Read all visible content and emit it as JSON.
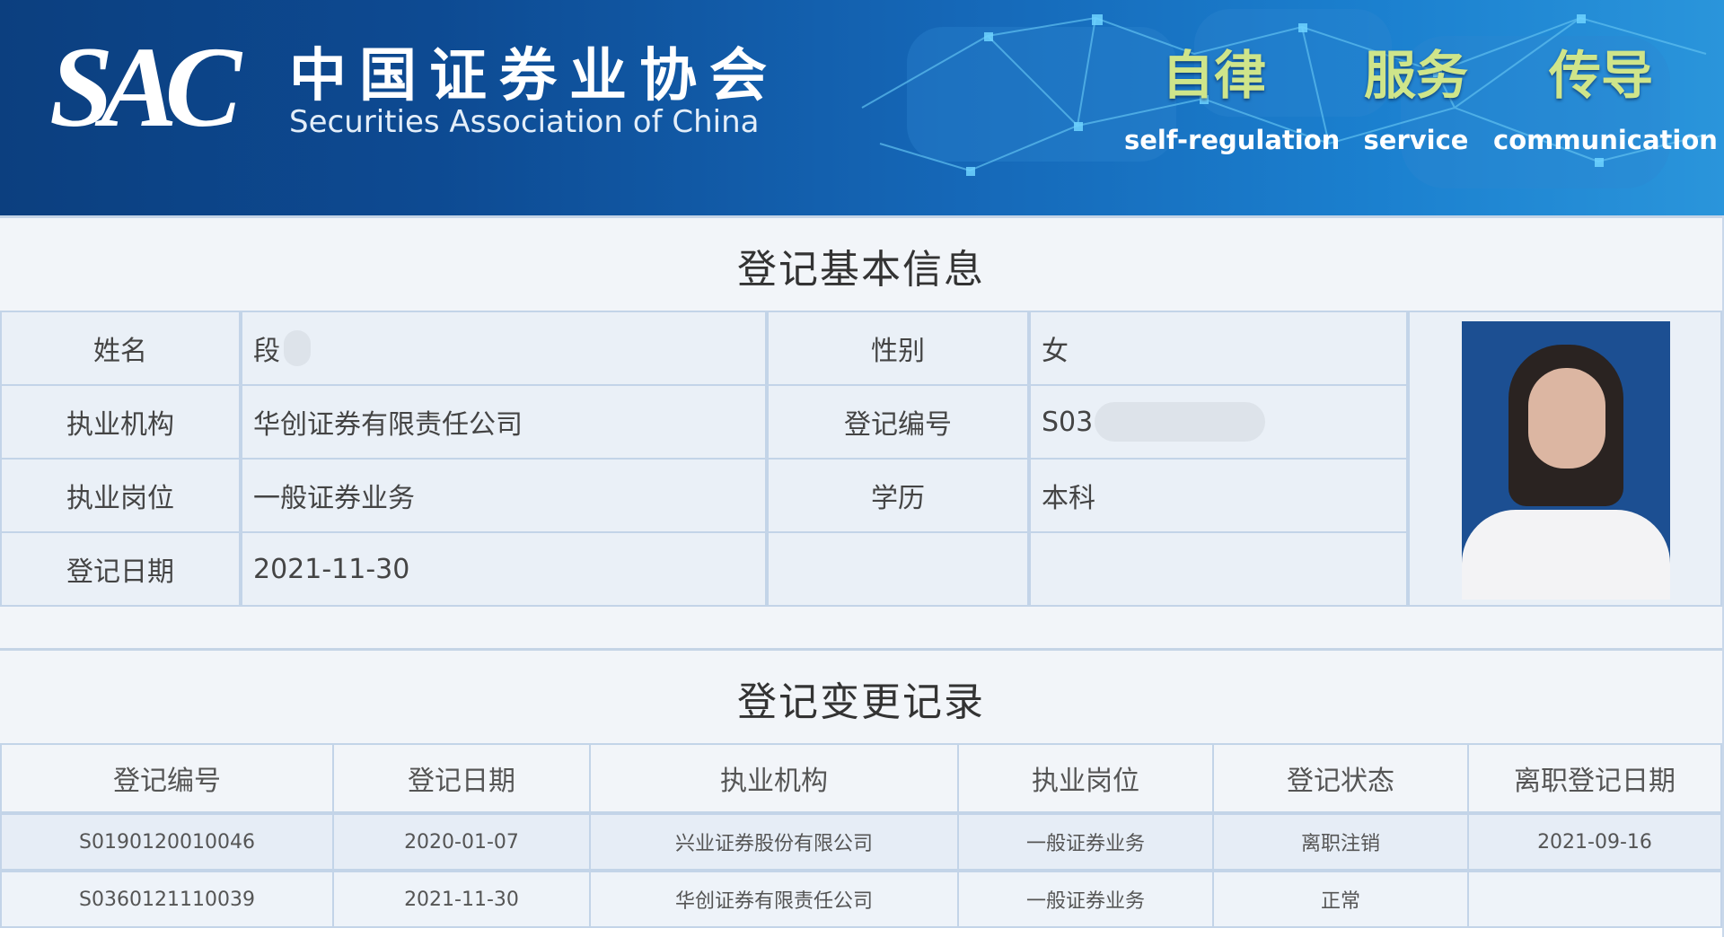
{
  "header": {
    "logo_text": "SAC",
    "org_name_cn": "中国证券业协会",
    "org_name_en": "Securities Association of China",
    "slogans": [
      {
        "cn": "自律",
        "en": "self-regulation"
      },
      {
        "cn": "服务",
        "en": "service"
      },
      {
        "cn": "传导",
        "en": "communication"
      }
    ]
  },
  "basic_info": {
    "title": "登记基本信息",
    "rows": [
      {
        "label1": "姓名",
        "value1": "段",
        "label2": "性别",
        "value2": "女"
      },
      {
        "label1": "执业机构",
        "value1": "华创证券有限责任公司",
        "label2": "登记编号",
        "value2": "S03"
      },
      {
        "label1": "执业岗位",
        "value1": "一般证券业务",
        "label2": "学历",
        "value2": "本科"
      },
      {
        "label1": "登记日期",
        "value1": "2021-11-30",
        "label2": "",
        "value2": ""
      }
    ]
  },
  "change_records": {
    "title": "登记变更记录",
    "columns": [
      "登记编号",
      "登记日期",
      "执业机构",
      "执业岗位",
      "登记状态",
      "离职登记日期"
    ],
    "rows": [
      [
        "S0190120010046",
        "2020-01-07",
        "兴业证券股份有限公司",
        "一般证券业务",
        "离职注销",
        "2021-09-16"
      ],
      [
        "S0360121110039",
        "2021-11-30",
        "华创证券有限责任公司",
        "一般证券业务",
        "正常",
        ""
      ]
    ]
  },
  "colors": {
    "banner_dark": "#0c3f7f",
    "banner_light": "#2a95db",
    "slogan_green": "#cfe58a",
    "cell_bg": "#eaf0f7",
    "border": "#c3d4e8"
  }
}
